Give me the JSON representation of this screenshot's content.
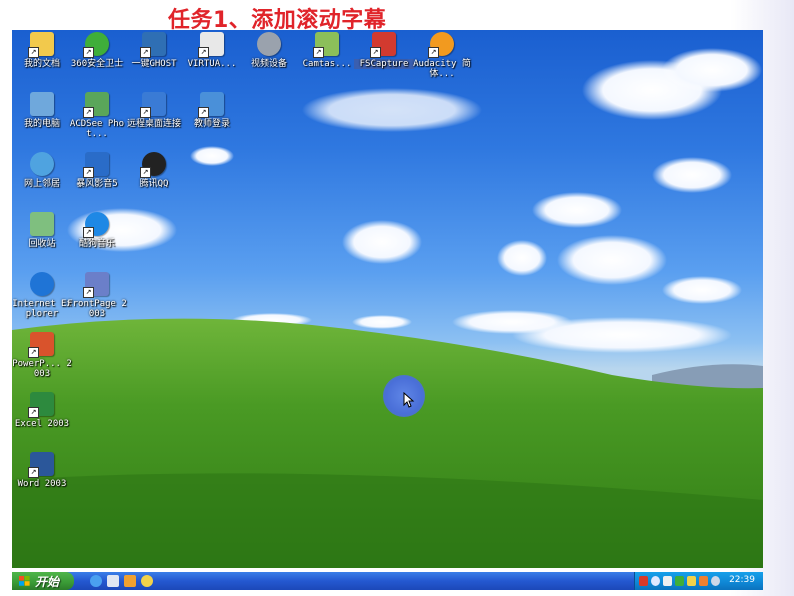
{
  "slide_title": "任务1、添加滚动字幕",
  "desktop": {
    "icons": [
      {
        "label": "我的文档",
        "icon": "my-documents-icon",
        "color": "#f2c94c"
      },
      {
        "label": "360安全卫士",
        "icon": "360-security-icon",
        "color": "#3fae3a"
      },
      {
        "label": "一键GHOST",
        "icon": "ghost-icon",
        "color": "#2f6fb4"
      },
      {
        "label": "VIRTUA...",
        "icon": "virtual-drive-icon",
        "color": "#e8e8e8"
      },
      {
        "label": "视频设备",
        "icon": "webcam-icon",
        "color": "#9aa2ad"
      },
      {
        "label": "Camtas...",
        "icon": "camtasia-icon",
        "color": "#8cbf5a"
      },
      {
        "label": "FSCapture",
        "icon": "fscapture-icon",
        "color": "#d23a2f"
      },
      {
        "label": "Audacity 简体...",
        "icon": "audacity-icon",
        "color": "#f29a1f"
      },
      {
        "label": "我的电脑",
        "icon": "my-computer-icon",
        "color": "#6fa8dc"
      },
      {
        "label": "ACDSee Phot...",
        "icon": "acdsee-icon",
        "color": "#5aa65a"
      },
      {
        "label": "远程桌面连接",
        "icon": "remote-desktop-icon",
        "color": "#3a7bd5"
      },
      {
        "label": "教师登录",
        "icon": "teacher-login-icon",
        "color": "#4a90d9"
      },
      {
        "label": "网上邻居",
        "icon": "network-places-icon",
        "color": "#4fa3e0"
      },
      {
        "label": "暴风影音5",
        "icon": "baofeng-icon",
        "color": "#2a6cc8"
      },
      {
        "label": "腾讯QQ",
        "icon": "qq-icon",
        "color": "#222222"
      },
      {
        "label": "回收站",
        "icon": "recycle-bin-icon",
        "color": "#7fbf7f"
      },
      {
        "label": "酷狗音乐",
        "icon": "kugou-icon",
        "color": "#1e88e5"
      },
      {
        "label": "Internet Explorer",
        "icon": "internet-explorer-icon",
        "color": "#1f74d6"
      },
      {
        "label": "FrontPage 2003",
        "icon": "frontpage-icon",
        "color": "#6b7fc9"
      },
      {
        "label": "PowerP... 2003",
        "icon": "powerpoint-icon",
        "color": "#d9532c"
      },
      {
        "label": "Excel 2003",
        "icon": "excel-icon",
        "color": "#2d8a3e"
      },
      {
        "label": "Word 2003",
        "icon": "word-icon",
        "color": "#2b579a"
      }
    ]
  },
  "taskbar": {
    "start_label": "开始",
    "quick_launch": [
      {
        "icon": "ie-quicklaunch-icon",
        "color": "#4aa0f0"
      },
      {
        "icon": "show-desktop-icon",
        "color": "#e0e6f2"
      },
      {
        "icon": "media-player-icon",
        "color": "#f0a030"
      },
      {
        "icon": "qq-quicklaunch-icon",
        "color": "#f2d24a"
      }
    ],
    "tray_icons": [
      {
        "icon": "input-method-icon",
        "color": "#d83a2a"
      },
      {
        "icon": "network-tray-icon",
        "color": "#e0e8ff"
      },
      {
        "icon": "volume-tray-icon",
        "color": "#f0f0f0"
      },
      {
        "icon": "security-tray-icon",
        "color": "#3fae3a"
      },
      {
        "icon": "qq-tray-icon",
        "color": "#f2d24a"
      },
      {
        "icon": "update-tray-icon",
        "color": "#f08030"
      },
      {
        "icon": "speaker-tray-icon",
        "color": "#d0d8e8"
      }
    ],
    "clock": "22:39"
  }
}
